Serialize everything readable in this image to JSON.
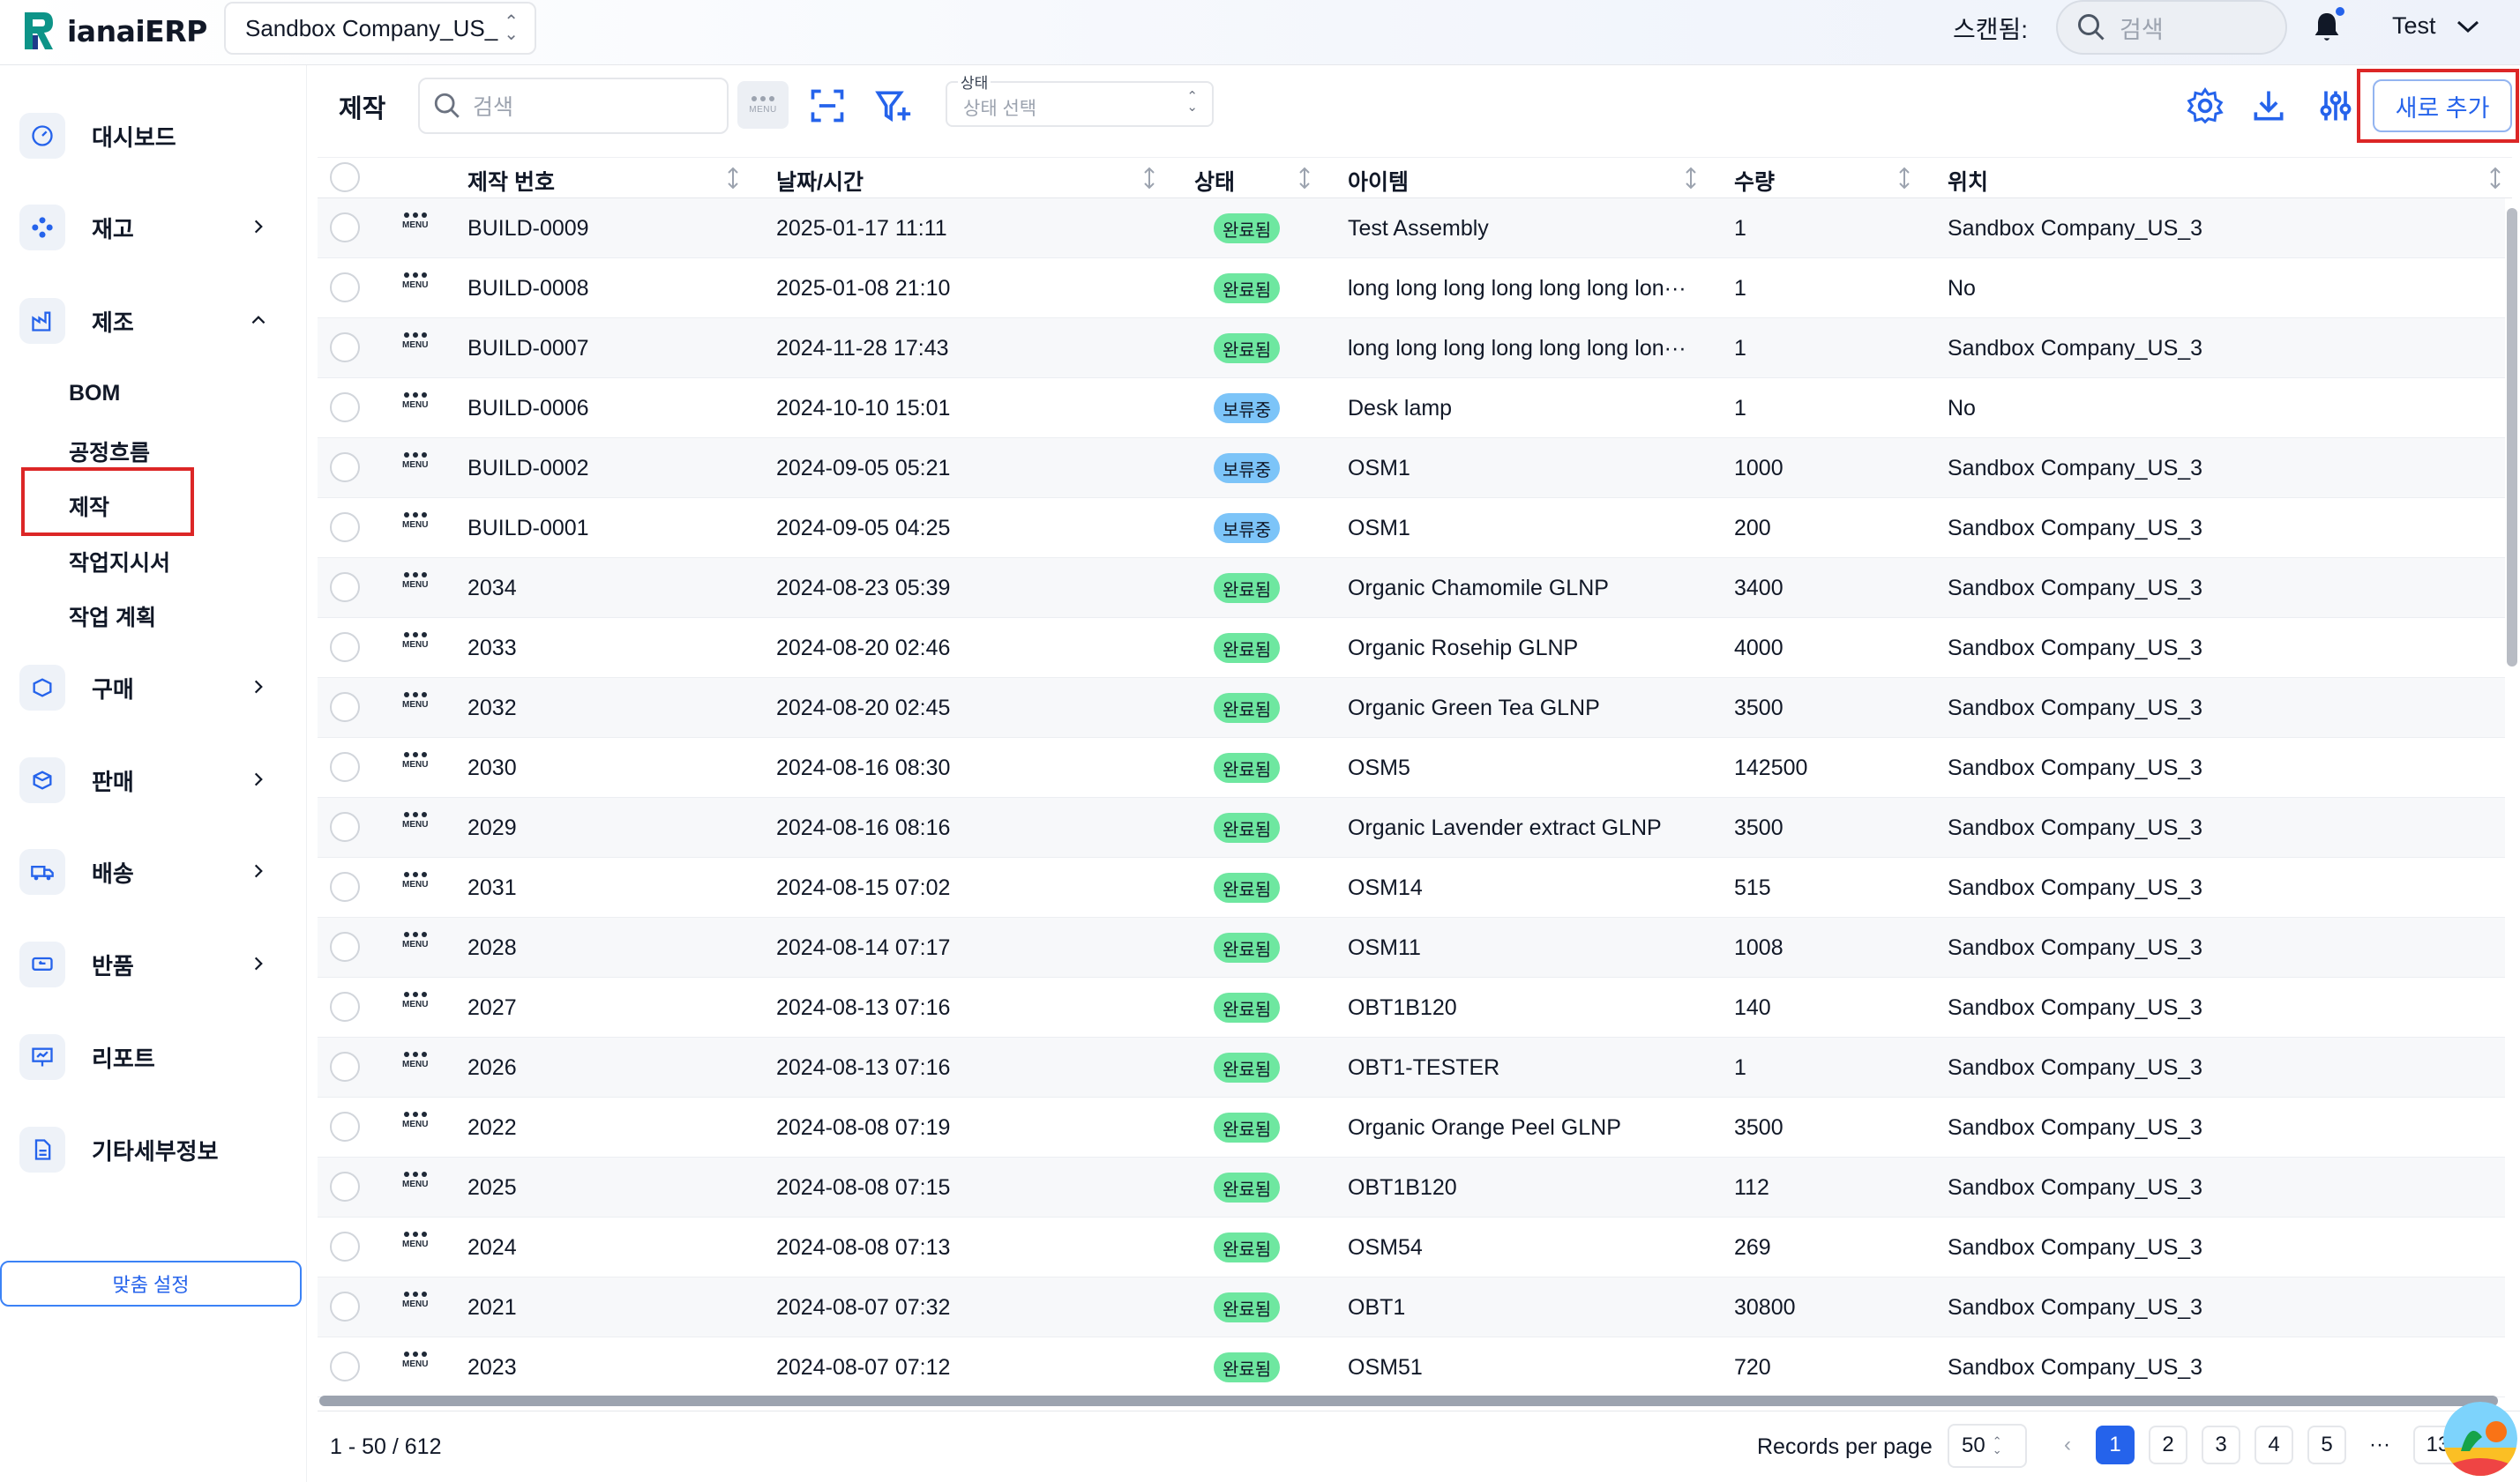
{
  "app": {
    "name": "ianaiERP",
    "company": "Sandbox Company_US_"
  },
  "topbar": {
    "scan_label": "스캔됨:",
    "search_placeholder": "검색",
    "user": "Test"
  },
  "sidebar": {
    "items": [
      {
        "label": "대시보드"
      },
      {
        "label": "재고"
      },
      {
        "label": "제조"
      },
      {
        "label": "구매"
      },
      {
        "label": "판매"
      },
      {
        "label": "배송"
      },
      {
        "label": "반품"
      },
      {
        "label": "리포트"
      },
      {
        "label": "기타세부정보"
      }
    ],
    "sub_items": [
      "BOM",
      "공정흐름",
      "제작",
      "작업지시서",
      "작업 계획"
    ],
    "custom_button": "맞춤 설정"
  },
  "toolbar": {
    "title": "제작",
    "search_placeholder": "검색",
    "menu_text": "MENU",
    "status_label": "상태",
    "status_placeholder": "상태 선택",
    "add_button": "새로 추가"
  },
  "table": {
    "headers": [
      "제작 번호",
      "날짜/시간",
      "상태",
      "아이템",
      "수량",
      "위치"
    ],
    "rows": [
      {
        "id": "BUILD-0009",
        "datetime": "2025-01-17 11:11",
        "status": "완료됨",
        "status_type": "done",
        "item": "Test Assembly",
        "qty": "1",
        "location": "Sandbox Company_US_3"
      },
      {
        "id": "BUILD-0008",
        "datetime": "2025-01-08 21:10",
        "status": "완료됨",
        "status_type": "done",
        "item": "long long long long long long lon···",
        "qty": "1",
        "location": "No"
      },
      {
        "id": "BUILD-0007",
        "datetime": "2024-11-28 17:43",
        "status": "완료됨",
        "status_type": "done",
        "item": "long long long long long long lon···",
        "qty": "1",
        "location": "Sandbox Company_US_3"
      },
      {
        "id": "BUILD-0006",
        "datetime": "2024-10-10 15:01",
        "status": "보류중",
        "status_type": "hold",
        "item": "Desk lamp",
        "qty": "1",
        "location": "No"
      },
      {
        "id": "BUILD-0002",
        "datetime": "2024-09-05 05:21",
        "status": "보류중",
        "status_type": "hold",
        "item": "OSM1",
        "qty": "1000",
        "location": "Sandbox Company_US_3"
      },
      {
        "id": "BUILD-0001",
        "datetime": "2024-09-05 04:25",
        "status": "보류중",
        "status_type": "hold",
        "item": "OSM1",
        "qty": "200",
        "location": "Sandbox Company_US_3"
      },
      {
        "id": "2034",
        "datetime": "2024-08-23 05:39",
        "status": "완료됨",
        "status_type": "done",
        "item": "Organic Chamomile GLNP",
        "qty": "3400",
        "location": "Sandbox Company_US_3"
      },
      {
        "id": "2033",
        "datetime": "2024-08-20 02:46",
        "status": "완료됨",
        "status_type": "done",
        "item": "Organic Rosehip GLNP",
        "qty": "4000",
        "location": "Sandbox Company_US_3"
      },
      {
        "id": "2032",
        "datetime": "2024-08-20 02:45",
        "status": "완료됨",
        "status_type": "done",
        "item": "Organic Green Tea GLNP",
        "qty": "3500",
        "location": "Sandbox Company_US_3"
      },
      {
        "id": "2030",
        "datetime": "2024-08-16 08:30",
        "status": "완료됨",
        "status_type": "done",
        "item": "OSM5",
        "qty": "142500",
        "location": "Sandbox Company_US_3"
      },
      {
        "id": "2029",
        "datetime": "2024-08-16 08:16",
        "status": "완료됨",
        "status_type": "done",
        "item": "Organic Lavender extract GLNP",
        "qty": "3500",
        "location": "Sandbox Company_US_3"
      },
      {
        "id": "2031",
        "datetime": "2024-08-15 07:02",
        "status": "완료됨",
        "status_type": "done",
        "item": "OSM14",
        "qty": "515",
        "location": "Sandbox Company_US_3"
      },
      {
        "id": "2028",
        "datetime": "2024-08-14 07:17",
        "status": "완료됨",
        "status_type": "done",
        "item": "OSM11",
        "qty": "1008",
        "location": "Sandbox Company_US_3"
      },
      {
        "id": "2027",
        "datetime": "2024-08-13 07:16",
        "status": "완료됨",
        "status_type": "done",
        "item": "OBT1B120",
        "qty": "140",
        "location": "Sandbox Company_US_3"
      },
      {
        "id": "2026",
        "datetime": "2024-08-13 07:16",
        "status": "완료됨",
        "status_type": "done",
        "item": "OBT1-TESTER",
        "qty": "1",
        "location": "Sandbox Company_US_3"
      },
      {
        "id": "2022",
        "datetime": "2024-08-08 07:19",
        "status": "완료됨",
        "status_type": "done",
        "item": "Organic Orange Peel GLNP",
        "qty": "3500",
        "location": "Sandbox Company_US_3"
      },
      {
        "id": "2025",
        "datetime": "2024-08-08 07:15",
        "status": "완료됨",
        "status_type": "done",
        "item": "OBT1B120",
        "qty": "112",
        "location": "Sandbox Company_US_3"
      },
      {
        "id": "2024",
        "datetime": "2024-08-08 07:13",
        "status": "완료됨",
        "status_type": "done",
        "item": "OSM54",
        "qty": "269",
        "location": "Sandbox Company_US_3"
      },
      {
        "id": "2021",
        "datetime": "2024-08-07 07:32",
        "status": "완료됨",
        "status_type": "done",
        "item": "OBT1",
        "qty": "30800",
        "location": "Sandbox Company_US_3"
      },
      {
        "id": "2023",
        "datetime": "2024-08-07 07:12",
        "status": "완료됨",
        "status_type": "done",
        "item": "OSM51",
        "qty": "720",
        "location": "Sandbox Company_US_3"
      }
    ]
  },
  "footer": {
    "range": "1 - 50 / 612",
    "records_per_page_label": "Records per page",
    "records_per_page": "50",
    "pages": [
      "1",
      "2",
      "3",
      "4",
      "5"
    ],
    "ellipsis": "···",
    "last_page": "13",
    "current_page": "1"
  },
  "colors": {
    "accent": "#2563eb",
    "done": "#6ee7a0",
    "hold": "#7cc4f8",
    "highlight": "#dc2626"
  }
}
